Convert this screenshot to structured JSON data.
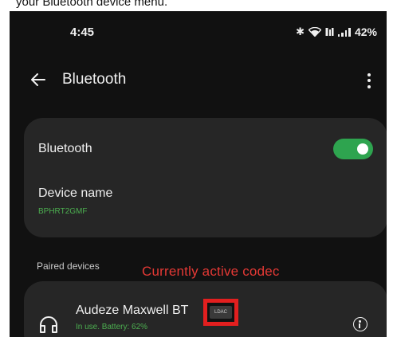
{
  "caption": {
    "text": "your Bluetooth device menu."
  },
  "status_bar": {
    "time": "4:45",
    "battery_percent": "42%",
    "icons": [
      "bluetooth-icon",
      "wifi-icon",
      "volte-icon",
      "signal-icon"
    ]
  },
  "app_bar": {
    "title": "Bluetooth",
    "back_icon": "arrow-left-icon",
    "menu_icon": "more-vert-icon"
  },
  "bluetooth_card": {
    "toggle_label": "Bluetooth",
    "toggle_on": true,
    "device_name_label": "Device name",
    "device_name_value": "BPHRT2GMF"
  },
  "paired_section": {
    "label": "Paired devices"
  },
  "annotation": {
    "text": "Currently active codec",
    "color": "#e53935"
  },
  "paired_devices": [
    {
      "name": "Audeze Maxwell BT",
      "codec": "LDAC",
      "status": "In use. Battery: 62%",
      "icon": "headphones-icon",
      "action_icon": "info-icon"
    }
  ],
  "colors": {
    "accent": "#2ea44f",
    "secondary_text": "#4caf50",
    "background": "#111111",
    "card": "#262626",
    "highlight_border": "#e21f1f"
  }
}
